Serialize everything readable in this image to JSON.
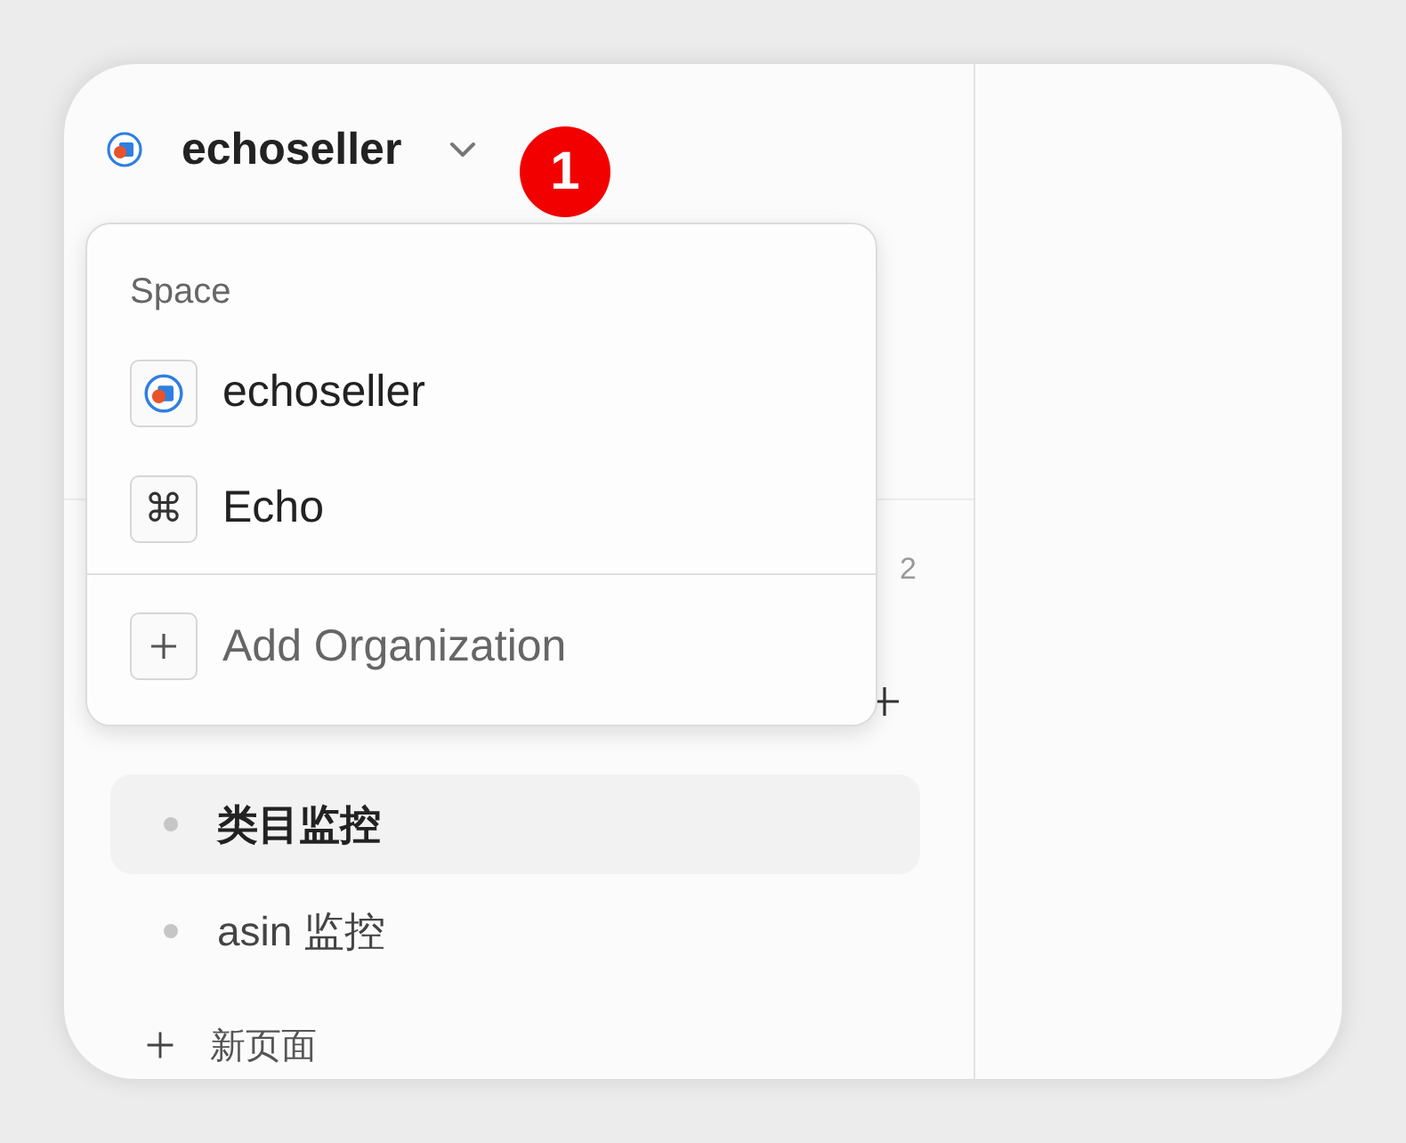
{
  "workspace": {
    "name": "echoseller",
    "menu_open": true
  },
  "badge": "1",
  "space_menu": {
    "heading": "Space",
    "spaces": [
      {
        "name": "echoseller",
        "kind": "logo"
      },
      {
        "name": "Echo",
        "kind": "glyph",
        "glyph": "⌘"
      }
    ],
    "add_label": "Add Organization"
  },
  "sidebar": {
    "count": "2",
    "pages": [
      {
        "title": "类目监控",
        "selected": true
      },
      {
        "title": "asin 监控",
        "selected": false
      }
    ],
    "new_page_label": "新页面"
  }
}
